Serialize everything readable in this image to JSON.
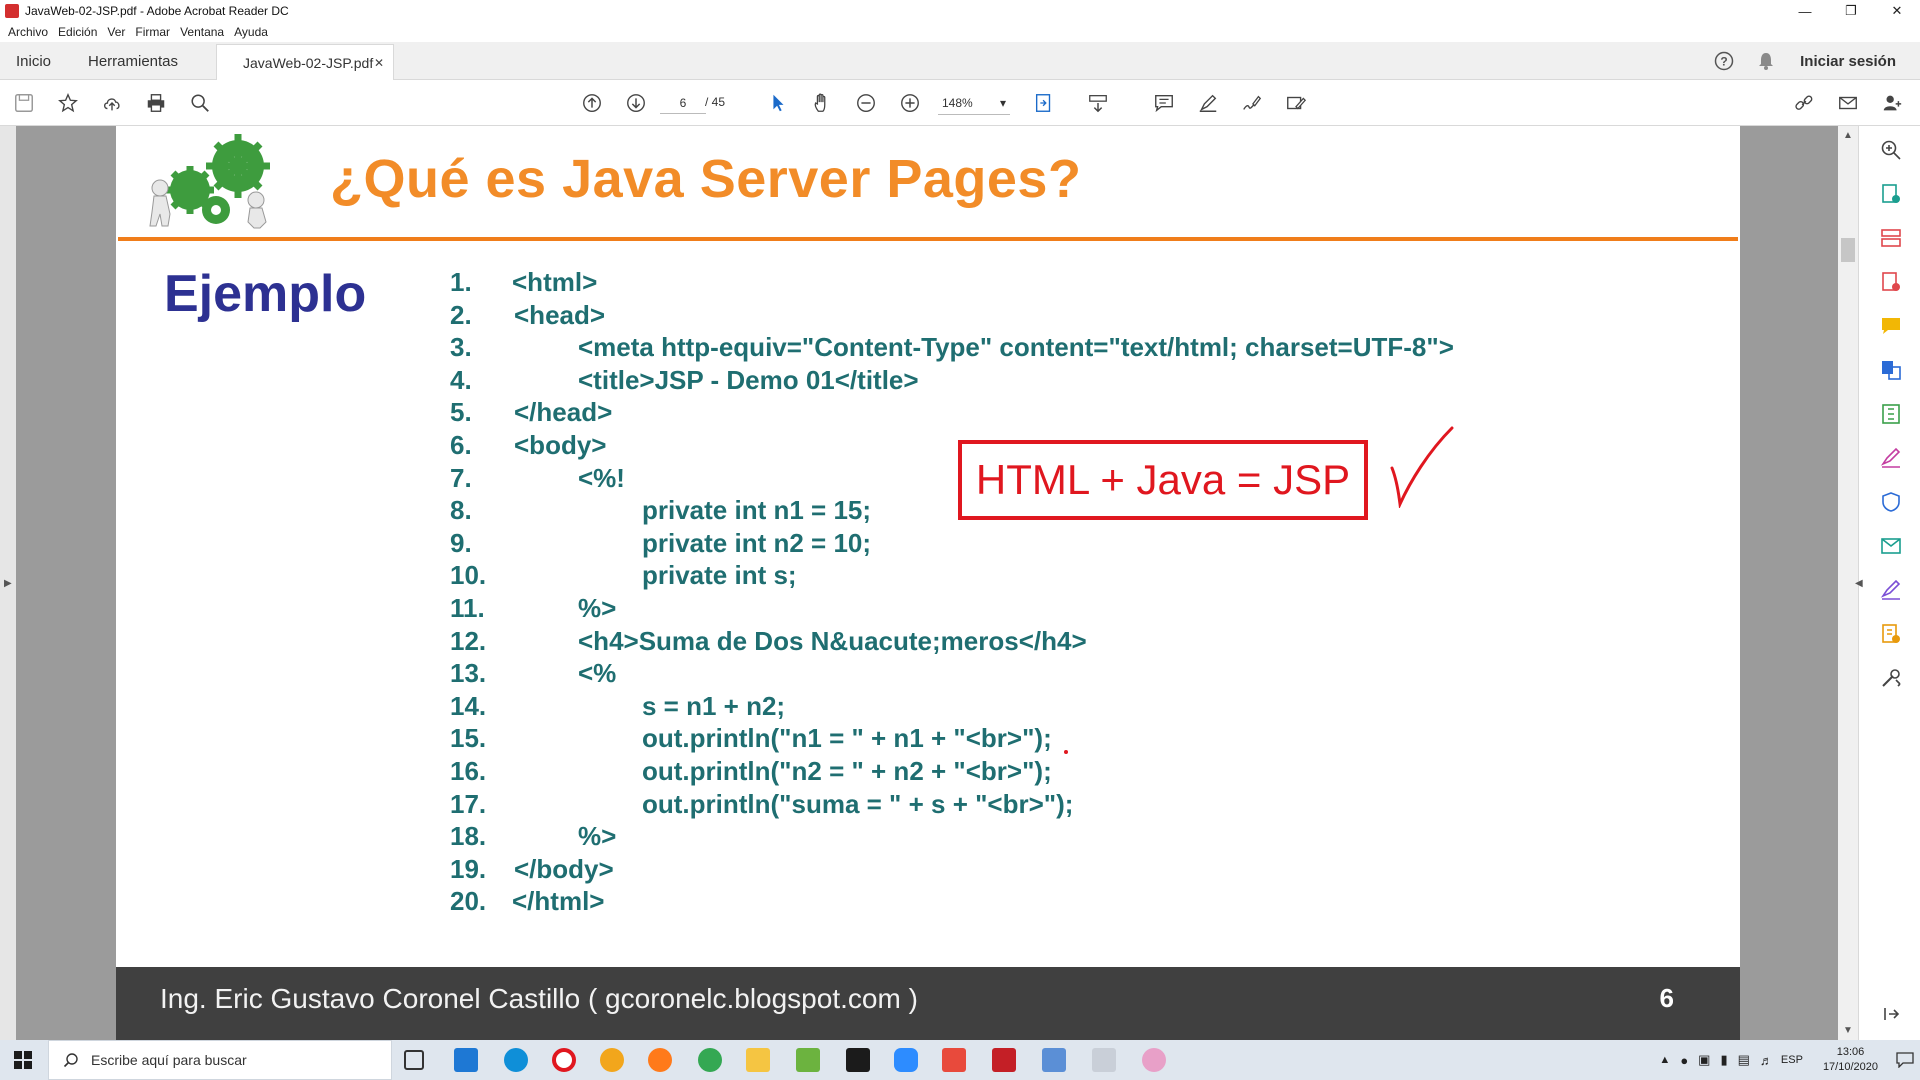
{
  "window": {
    "title": "JavaWeb-02-JSP.pdf - Adobe Acrobat Reader DC"
  },
  "menu": [
    "Archivo",
    "Edición",
    "Ver",
    "Firmar",
    "Ventana",
    "Ayuda"
  ],
  "tabs": {
    "home": "Inicio",
    "tools": "Herramientas",
    "document": "JavaWeb-02-JSP.pdf",
    "sign_in": "Iniciar sesión"
  },
  "toolbar": {
    "page_current": "6",
    "page_total": "/ 45",
    "zoom": "148%"
  },
  "slide": {
    "title": "¿Qué es Java Server Pages?",
    "subtitle": "Ejemplo",
    "callout": "HTML + Java = JSP",
    "footer_author": "Ing. Eric Gustavo Coronel Castillo ( gcoronelc.blogspot.com )",
    "footer_page": "6",
    "code": [
      {
        "n": "1.",
        "t": "<html>"
      },
      {
        "n": "2.",
        "t": "<head>"
      },
      {
        "n": "3.",
        "t": "<meta http-equiv=\"Content-Type\" content=\"text/html; charset=UTF-8\">"
      },
      {
        "n": "4.",
        "t": "<title>JSP - Demo 01</title>"
      },
      {
        "n": "5.",
        "t": "</head>"
      },
      {
        "n": "6.",
        "t": "<body>"
      },
      {
        "n": "7.",
        "t": "<%!"
      },
      {
        "n": "8.",
        "t": "private int n1 = 15;"
      },
      {
        "n": "9.",
        "t": "private int n2 = 10;"
      },
      {
        "n": "10.",
        "t": "private int s;"
      },
      {
        "n": "11.",
        "t": "%>"
      },
      {
        "n": "12.",
        "t": "<h4>Suma de Dos N&uacute;meros</h4>"
      },
      {
        "n": "13.",
        "t": "<%"
      },
      {
        "n": "14.",
        "t": "s = n1 + n2;"
      },
      {
        "n": "15.",
        "t": "out.println(\"n1 = \" + n1 + \"<br>\");"
      },
      {
        "n": "16.",
        "t": "out.println(\"n2 = \" + n2 + \"<br>\");"
      },
      {
        "n": "17.",
        "t": "out.println(\"suma = \" + s + \"<br>\");"
      },
      {
        "n": "18.",
        "t": "%>"
      },
      {
        "n": "19.",
        "t": "</body>"
      },
      {
        "n": "20.",
        "t": "</html>"
      }
    ]
  },
  "taskbar": {
    "search_placeholder": "Escribe aquí para buscar",
    "language": "ESP",
    "time": "13:06",
    "date": "17/10/2020"
  },
  "colors": {
    "title_orange": "#f28c28",
    "rule_orange": "#f07d1a",
    "heading_blue": "#2d3192",
    "code_teal": "#1f6e71",
    "callout_red": "#e0171f",
    "footer_gray": "#404040"
  }
}
